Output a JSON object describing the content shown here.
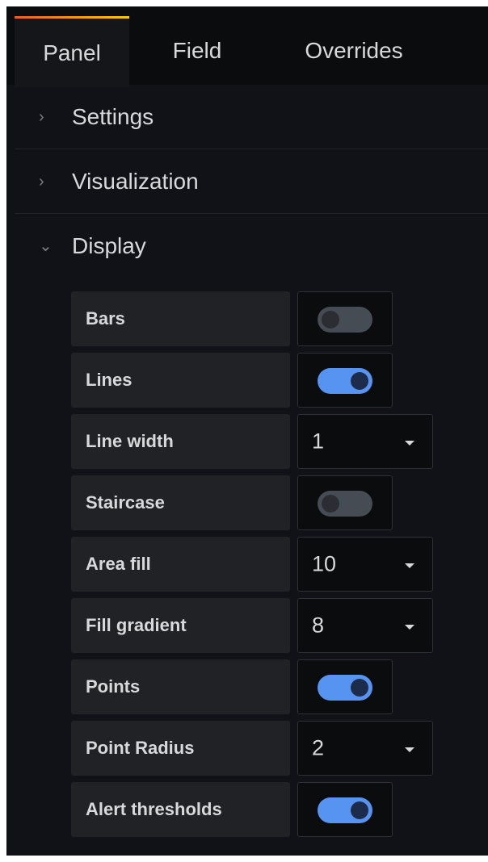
{
  "tabs": [
    {
      "label": "Panel",
      "active": true
    },
    {
      "label": "Field",
      "active": false
    },
    {
      "label": "Overrides",
      "active": false
    }
  ],
  "sections": {
    "settings": {
      "chevron": "›",
      "title": "Settings",
      "expanded": false
    },
    "visualization": {
      "chevron": "›",
      "title": "Visualization",
      "expanded": false
    },
    "display": {
      "chevron": "⌄",
      "title": "Display",
      "expanded": true
    }
  },
  "display_options": [
    {
      "label": "Bars",
      "type": "switch",
      "on": false
    },
    {
      "label": "Lines",
      "type": "switch",
      "on": true
    },
    {
      "label": "Line width",
      "type": "select",
      "value": "1"
    },
    {
      "label": "Staircase",
      "type": "switch",
      "on": false
    },
    {
      "label": "Area fill",
      "type": "select",
      "value": "10"
    },
    {
      "label": "Fill gradient",
      "type": "select",
      "value": "8"
    },
    {
      "label": "Points",
      "type": "switch",
      "on": true
    },
    {
      "label": "Point Radius",
      "type": "select",
      "value": "2"
    },
    {
      "label": "Alert thresholds",
      "type": "switch",
      "on": true
    }
  ],
  "colors": {
    "background": "#111217",
    "accent_blue": "#5794f2",
    "tab_gradient_start": "#f05a28",
    "tab_gradient_end": "#fbca0a"
  }
}
